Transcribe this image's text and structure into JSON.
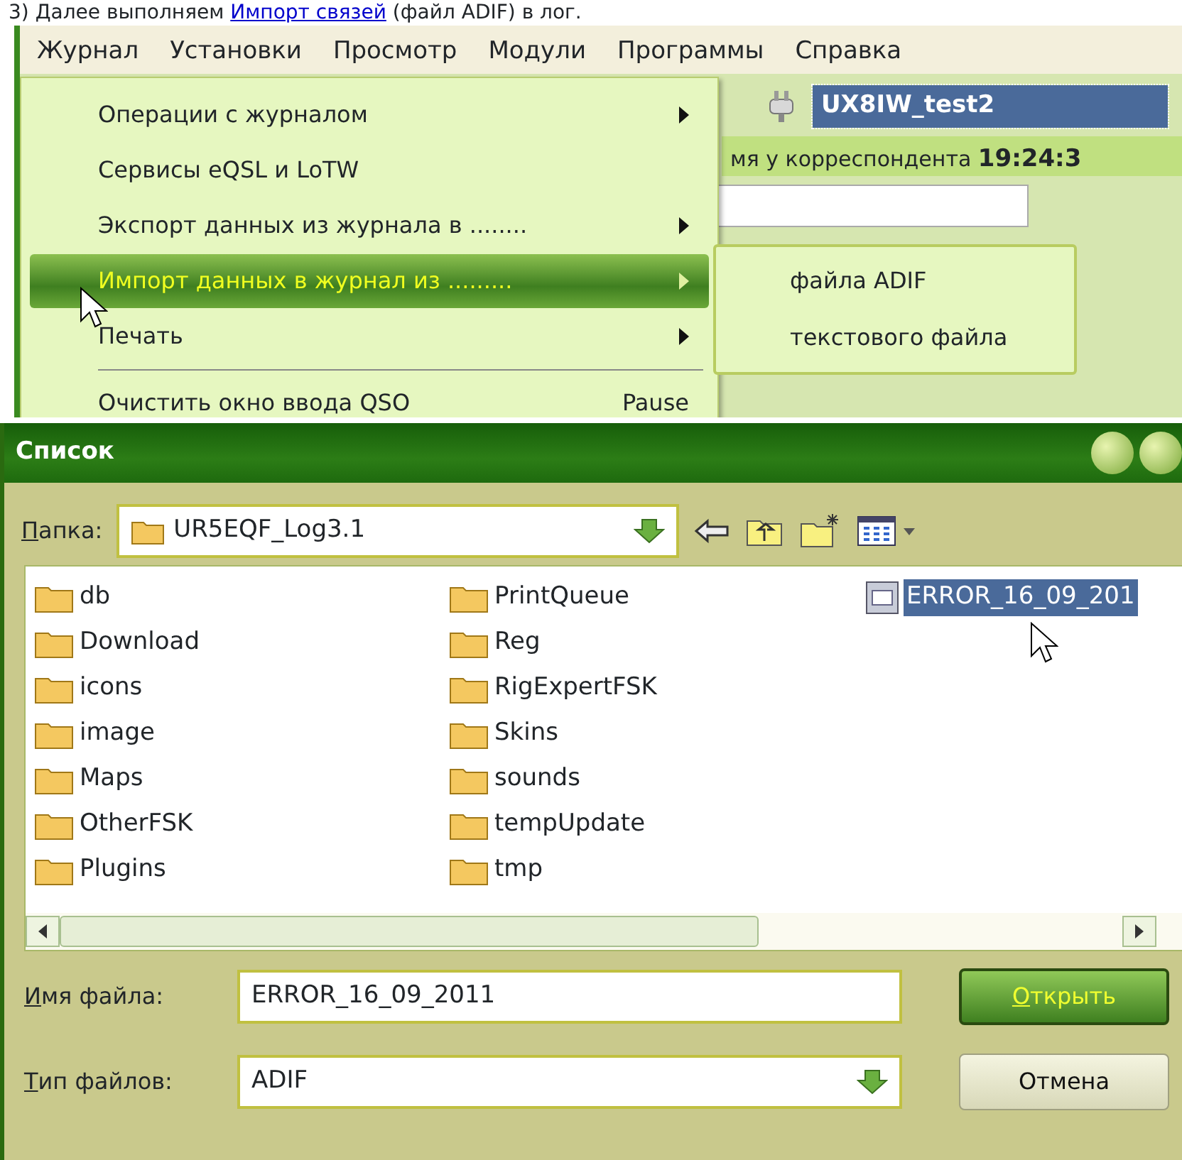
{
  "caption": {
    "before": "3) Далее выполняем ",
    "link": "Импорт связей",
    "after": " (файл ADIF) в лог."
  },
  "app": {
    "menu_bar": [
      {
        "label": "Журнал"
      },
      {
        "label": "Установки"
      },
      {
        "label": "Просмотр"
      },
      {
        "label": "Модули"
      },
      {
        "label": "Программы"
      },
      {
        "label": "Справка"
      }
    ],
    "background": {
      "profile": "UX8IW_test2",
      "time_label": "мя у корреспондента",
      "time": "19:24:3"
    },
    "menu": [
      {
        "kind": "item",
        "label": "Операции с журналом",
        "submenu": true,
        "selected": false
      },
      {
        "kind": "item",
        "label": "Сервисы eQSL и LoTW",
        "submenu": false,
        "selected": false
      },
      {
        "kind": "item",
        "label": "Экспорт данных из журнала в ........",
        "submenu": true,
        "selected": false
      },
      {
        "kind": "item",
        "label": "Импорт данных в журнал из .........",
        "submenu": true,
        "selected": true
      },
      {
        "kind": "item",
        "label": "Печать",
        "submenu": true,
        "selected": false
      },
      {
        "kind": "separator"
      },
      {
        "kind": "item",
        "label": "Очистить окно ввода QSO",
        "shortcut": "Pause",
        "submenu": false,
        "selected": false
      }
    ],
    "submenu": [
      {
        "label": "файла ADIF"
      },
      {
        "label": "текстового файла"
      }
    ]
  },
  "dialog": {
    "title": "Список",
    "folder_label": "Папка:",
    "folder": "UR5EQF_Log3.1",
    "files": [
      {
        "kind": "folder",
        "name": "db",
        "selected": false
      },
      {
        "kind": "folder",
        "name": "Download",
        "selected": false
      },
      {
        "kind": "folder",
        "name": "icons",
        "selected": false
      },
      {
        "kind": "folder",
        "name": "image",
        "selected": false
      },
      {
        "kind": "folder",
        "name": "Maps",
        "selected": false
      },
      {
        "kind": "folder",
        "name": "OtherFSK",
        "selected": false
      },
      {
        "kind": "folder",
        "name": "Plugins",
        "selected": false
      },
      {
        "kind": "folder",
        "name": "PrintQueue",
        "selected": false
      },
      {
        "kind": "folder",
        "name": "Reg",
        "selected": false
      },
      {
        "kind": "folder",
        "name": "RigExpertFSK",
        "selected": false
      },
      {
        "kind": "folder",
        "name": "Skins",
        "selected": false
      },
      {
        "kind": "folder",
        "name": "sounds",
        "selected": false
      },
      {
        "kind": "folder",
        "name": "tempUpdate",
        "selected": false
      },
      {
        "kind": "folder",
        "name": "tmp",
        "selected": false
      },
      {
        "kind": "file",
        "name": "ERROR_16_09_201",
        "selected": true
      }
    ],
    "filename_label": "Имя файла:",
    "filename": "ERROR_16_09_2011",
    "filetype_label": "Тип файлов:",
    "filetype": "ADIF",
    "buttons": [
      {
        "label": "Открыть",
        "default": true
      },
      {
        "label": "Отмена",
        "default": false
      }
    ]
  }
}
